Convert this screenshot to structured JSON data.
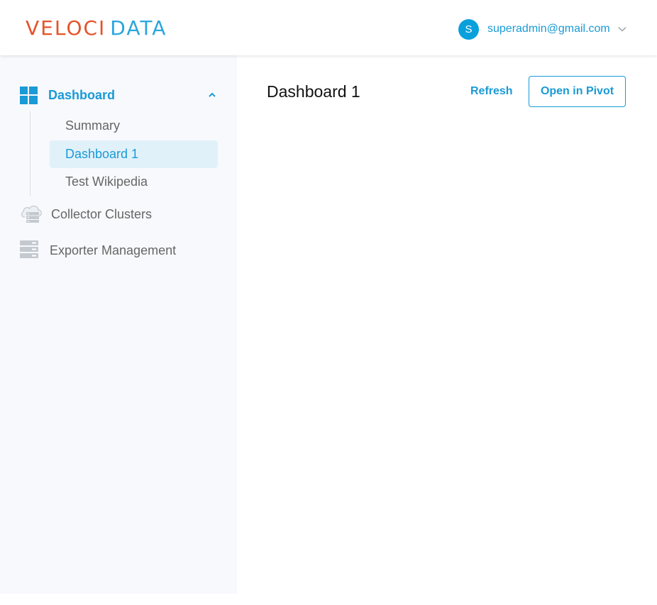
{
  "brand": {
    "logo_part_a": "VELOCI",
    "logo_part_b": "DATA",
    "color_a": "#e5532a",
    "color_b": "#2aa6de"
  },
  "user": {
    "avatar_initial": "S",
    "email": "superadmin@gmail.com",
    "menu_icon": "chevron-down-icon"
  },
  "sidebar": {
    "group": {
      "label": "Dashboard",
      "icon": "dashboard-grid-icon",
      "expanded": true,
      "caret_icon": "chevron-up-icon",
      "items": [
        {
          "label": "Summary",
          "active": false
        },
        {
          "label": "Dashboard 1",
          "active": true
        },
        {
          "label": "Test Wikipedia",
          "active": false
        }
      ]
    },
    "items": [
      {
        "label": "Collector Clusters",
        "icon": "cloud-server-icon"
      },
      {
        "label": "Exporter Management",
        "icon": "server-rack-icon"
      }
    ]
  },
  "main": {
    "title": "Dashboard 1",
    "refresh_label": "Refresh",
    "open_pivot_label": "Open in Pivot"
  },
  "colors": {
    "accent": "#1a9ad6",
    "active_background": "#e1f1fa",
    "sidebar_background": "#f7f9fc"
  }
}
